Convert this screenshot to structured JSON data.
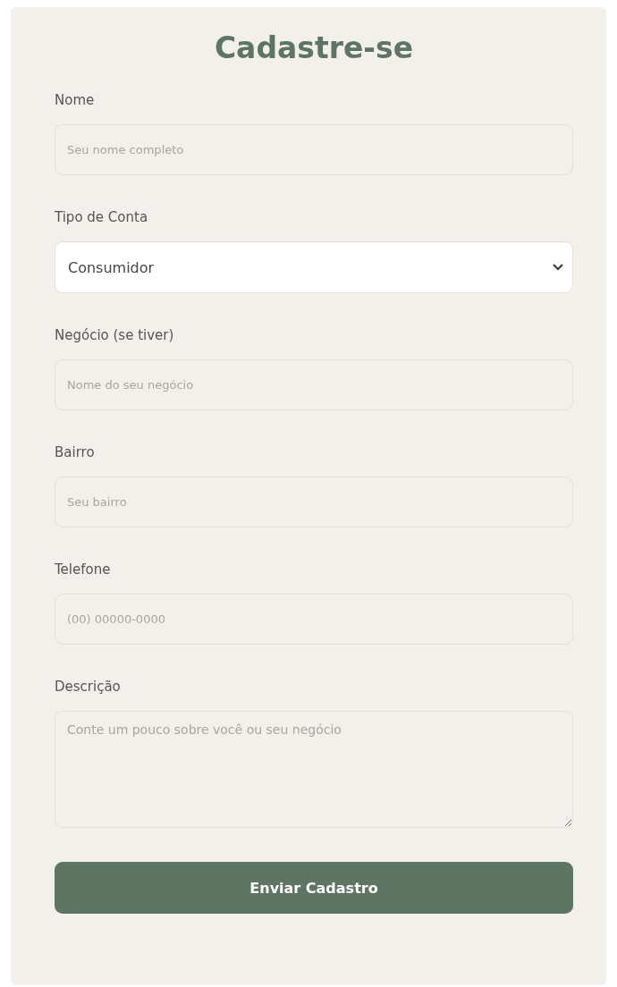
{
  "title": "Cadastre-se",
  "fields": [
    {
      "kind": "input",
      "label": "Nome",
      "placeholder": "Seu nome completo"
    },
    {
      "kind": "select",
      "label": "Tipo de Conta",
      "value": "Consumidor"
    },
    {
      "kind": "input",
      "label": "Negócio (se tiver)",
      "placeholder": "Nome do seu negócio"
    },
    {
      "kind": "input",
      "label": "Bairro",
      "placeholder": "Seu bairro"
    },
    {
      "kind": "input",
      "label": "Telefone",
      "placeholder": "(00) 00000-0000"
    },
    {
      "kind": "textarea",
      "label": "Descrição",
      "placeholder": "Conte um pouco sobre você ou seu negócio"
    }
  ],
  "submit": "Enviar Cadastro"
}
